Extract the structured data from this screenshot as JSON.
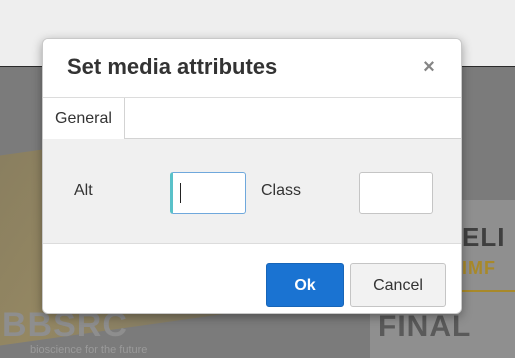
{
  "background": {
    "heading_fragment": "ELI",
    "subheading_fragment": "IMF",
    "bottom_fragment": "FINAL",
    "logo_text": "BBSRC",
    "logo_tagline": "bioscience for the future"
  },
  "dialog": {
    "title": "Set media attributes",
    "close_glyph": "×",
    "tabs": [
      {
        "label": "General",
        "active": true
      }
    ],
    "fields": {
      "alt": {
        "label": "Alt",
        "value": ""
      },
      "class": {
        "label": "Class",
        "value": ""
      }
    },
    "buttons": {
      "ok": "Ok",
      "cancel": "Cancel"
    }
  },
  "colors": {
    "primary_button": "#1a73d2",
    "focus_accent": "#59c1c9"
  }
}
